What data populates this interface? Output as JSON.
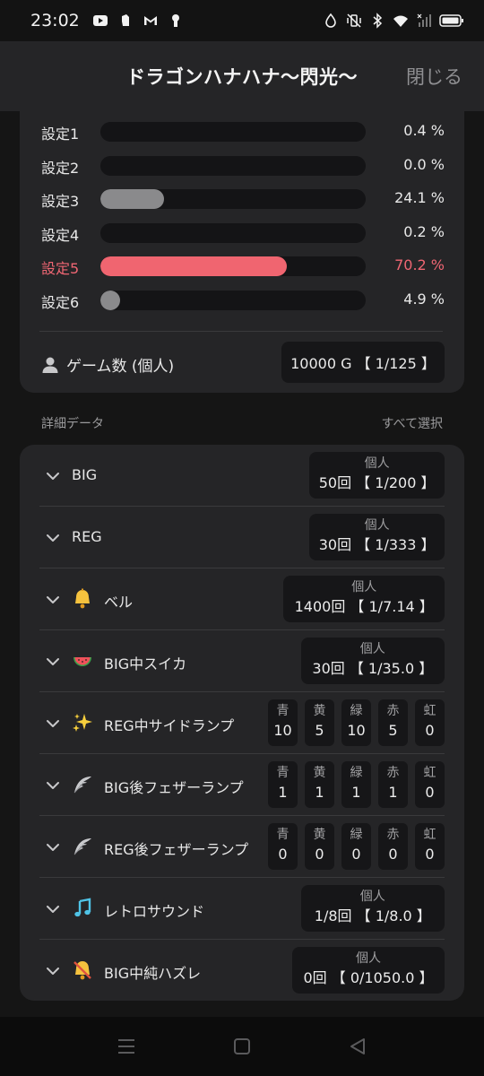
{
  "status_bar": {
    "time": "23:02",
    "left_icons": [
      "youtube-icon",
      "app-icon",
      "gmail-icon",
      "keyhole-icon"
    ],
    "right_icons": [
      "water-drop-icon",
      "mute-vibrate-icon",
      "bluetooth-icon",
      "wifi-icon",
      "signal-icon",
      "battery-icon"
    ]
  },
  "header": {
    "title": "ドラゴンハナハナ〜閃光〜",
    "close_label": "閉じる"
  },
  "settings": [
    {
      "label": "設定1",
      "percent": 0.4,
      "percent_label": "0.4 %",
      "highlight": false
    },
    {
      "label": "設定2",
      "percent": 0.0,
      "percent_label": "0.0 %",
      "highlight": false
    },
    {
      "label": "設定3",
      "percent": 24.1,
      "percent_label": "24.1 %",
      "highlight": false
    },
    {
      "label": "設定4",
      "percent": 0.2,
      "percent_label": "0.2 %",
      "highlight": false
    },
    {
      "label": "設定5",
      "percent": 70.2,
      "percent_label": "70.2 %",
      "highlight": true
    },
    {
      "label": "設定6",
      "percent": 4.9,
      "percent_label": "4.9 %",
      "highlight": false
    }
  ],
  "games": {
    "label": "ゲーム数 (個人)",
    "value": "10000 G 【 1/125 】",
    "icon": "person-icon"
  },
  "details": {
    "section_title": "詳細データ",
    "select_all": "すべて選択",
    "rows": [
      {
        "label": "BIG",
        "icon": "",
        "type": "single",
        "head": "個人",
        "value": "50回 【 1/200 】"
      },
      {
        "label": "REG",
        "icon": "",
        "type": "single",
        "head": "個人",
        "value": "30回 【 1/333 】"
      },
      {
        "label": "ベル",
        "icon": "bell-icon",
        "type": "single",
        "head": "個人",
        "value": "1400回 【 1/7.14 】"
      },
      {
        "label": "BIG中スイカ",
        "icon": "watermelon-icon",
        "type": "single",
        "head": "個人",
        "value": "30回 【 1/35.0 】"
      },
      {
        "label": "REG中サイドランプ",
        "icon": "sparkles-icon",
        "type": "colors",
        "colors": [
          {
            "h": "青",
            "v": "10"
          },
          {
            "h": "黄",
            "v": "5"
          },
          {
            "h": "緑",
            "v": "10"
          },
          {
            "h": "赤",
            "v": "5"
          },
          {
            "h": "虹",
            "v": "0"
          }
        ]
      },
      {
        "label": "BIG後フェザーランプ",
        "icon": "feather-icon",
        "type": "colors",
        "colors": [
          {
            "h": "青",
            "v": "1"
          },
          {
            "h": "黄",
            "v": "1"
          },
          {
            "h": "緑",
            "v": "1"
          },
          {
            "h": "赤",
            "v": "1"
          },
          {
            "h": "虹",
            "v": "0"
          }
        ]
      },
      {
        "label": "REG後フェザーランプ",
        "icon": "feather-icon",
        "type": "colors",
        "colors": [
          {
            "h": "青",
            "v": "0"
          },
          {
            "h": "黄",
            "v": "0"
          },
          {
            "h": "緑",
            "v": "0"
          },
          {
            "h": "赤",
            "v": "0"
          },
          {
            "h": "虹",
            "v": "0"
          }
        ]
      },
      {
        "label": "レトロサウンド",
        "icon": "music-note-icon",
        "type": "single",
        "head": "個人",
        "value": "1/8回 【 1/8.0 】"
      },
      {
        "label": "BIG中純ハズレ",
        "icon": "bell-slash-icon",
        "type": "single",
        "head": "個人",
        "value": "0回 【 0/1050.0 】"
      }
    ]
  },
  "colors": {
    "highlight": "#f06570",
    "bar_default": "#8a8a8c",
    "card": "#252527",
    "background": "#151515"
  }
}
